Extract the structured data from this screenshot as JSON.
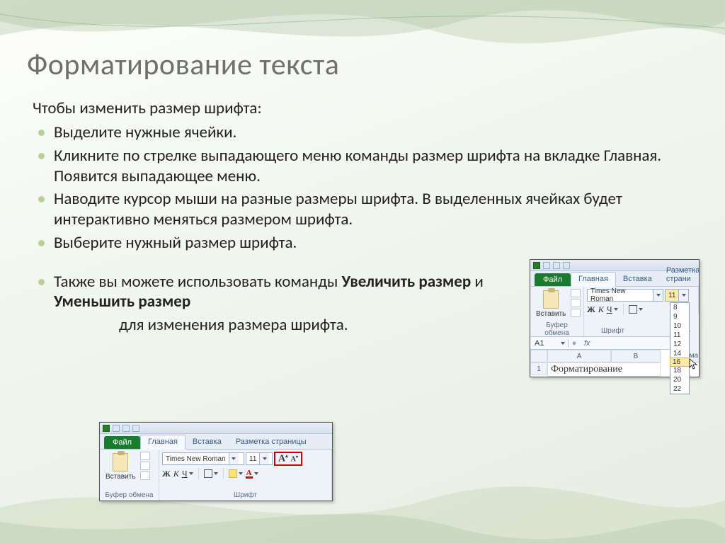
{
  "slide": {
    "title": "Форматирование текста",
    "intro": "Чтобы изменить размер шрифта:",
    "bullets": [
      "Выделите нужные ячейки.",
      "Кликните по стрелке выпадающего меню команды размер шрифта на вкладке Главная. Появится выпадающее меню.",
      "Наводите курсор мыши на разные размеры шрифта. В выделенных ячейках будет интерактивно меняться размером шрифта.",
      "Выберите нужный размер шрифта."
    ],
    "bullet5_pre": "Также вы можете использовать команды ",
    "bullet5_b1": "Увеличить размер",
    "bullet5_mid": " и ",
    "bullet5_b2": "Уменьшить размер",
    "bullet5_line2": "для изменения размера шрифта."
  },
  "excel": {
    "file_tab": "Файл",
    "tabs": {
      "home": "Главная",
      "insert": "Вставка",
      "layout": "Разметка страницы",
      "layout_short": "Разметка страни"
    },
    "paste_label": "Вставить",
    "group_clipboard": "Буфер обмена",
    "group_font": "Шрифт",
    "font_name": "Times New Roman",
    "font_size": "11",
    "fmt": {
      "b": "Ж",
      "i": "К",
      "u": "Ч"
    },
    "name_box": "A1",
    "colA": "A",
    "colB": "B",
    "row1": "1",
    "cell_text": "Форматирование",
    "right_label": "Форма",
    "sizes": [
      "8",
      "9",
      "10",
      "11",
      "12",
      "14",
      "16",
      "18",
      "20",
      "22"
    ],
    "size_hover": "16"
  }
}
